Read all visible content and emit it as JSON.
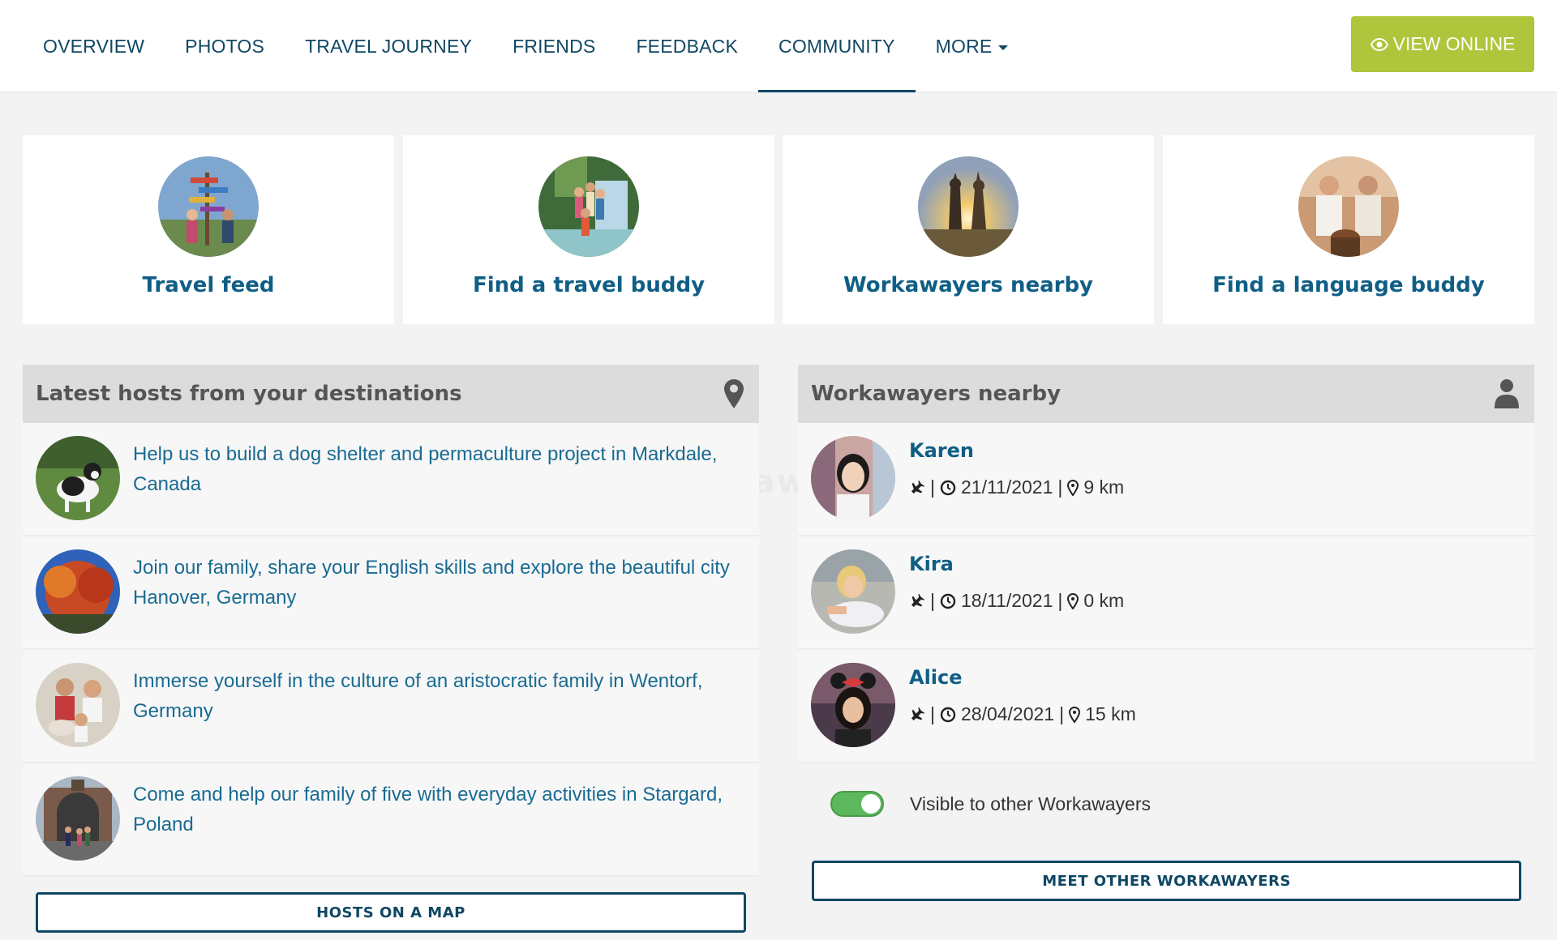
{
  "nav": {
    "items": [
      {
        "label": "OVERVIEW"
      },
      {
        "label": "PHOTOS"
      },
      {
        "label": "TRAVEL JOURNEY"
      },
      {
        "label": "FRIENDS"
      },
      {
        "label": "FEEDBACK"
      },
      {
        "label": "COMMUNITY",
        "active": true
      },
      {
        "label": "MORE"
      }
    ],
    "view_online_label": "VIEW ONLINE"
  },
  "cards": [
    {
      "title": "Travel feed"
    },
    {
      "title": "Find a travel buddy"
    },
    {
      "title": "Workawayers nearby"
    },
    {
      "title": "Find a language buddy"
    }
  ],
  "hosts_panel": {
    "title": "Latest hosts from your destinations",
    "icon": "map-marker-icon",
    "items": [
      {
        "text": "Help us to build a dog shelter and permaculture project in Markdale, Canada"
      },
      {
        "text": "Join our family, share your English skills and explore the beautiful city Hanover, Germany"
      },
      {
        "text": "Immerse yourself in the culture of an aristocratic family in Wentorf, Germany"
      },
      {
        "text": "Come and help our family of five with everyday activities in Stargard, Poland"
      }
    ],
    "button_label": "HOSTS ON A MAP"
  },
  "workawayers_panel": {
    "title": "Workawayers nearby",
    "icon": "user-icon",
    "items": [
      {
        "name": "Karen",
        "date": "21/11/2021",
        "distance": "9 km"
      },
      {
        "name": "Kira",
        "date": "18/11/2021",
        "distance": "0 km"
      },
      {
        "name": "Alice",
        "date": "28/04/2021",
        "distance": "15 km"
      }
    ],
    "separator": "|",
    "visibility_label": "Visible to other Workawayers",
    "visibility_on": true,
    "button_label": "MEET OTHER WORKAWAYERS"
  },
  "watermark": "workaway",
  "colors": {
    "accent": "#0f4763",
    "link": "#1a6b92",
    "view_online": "#afc53b",
    "toggle_on": "#5cb85c"
  }
}
